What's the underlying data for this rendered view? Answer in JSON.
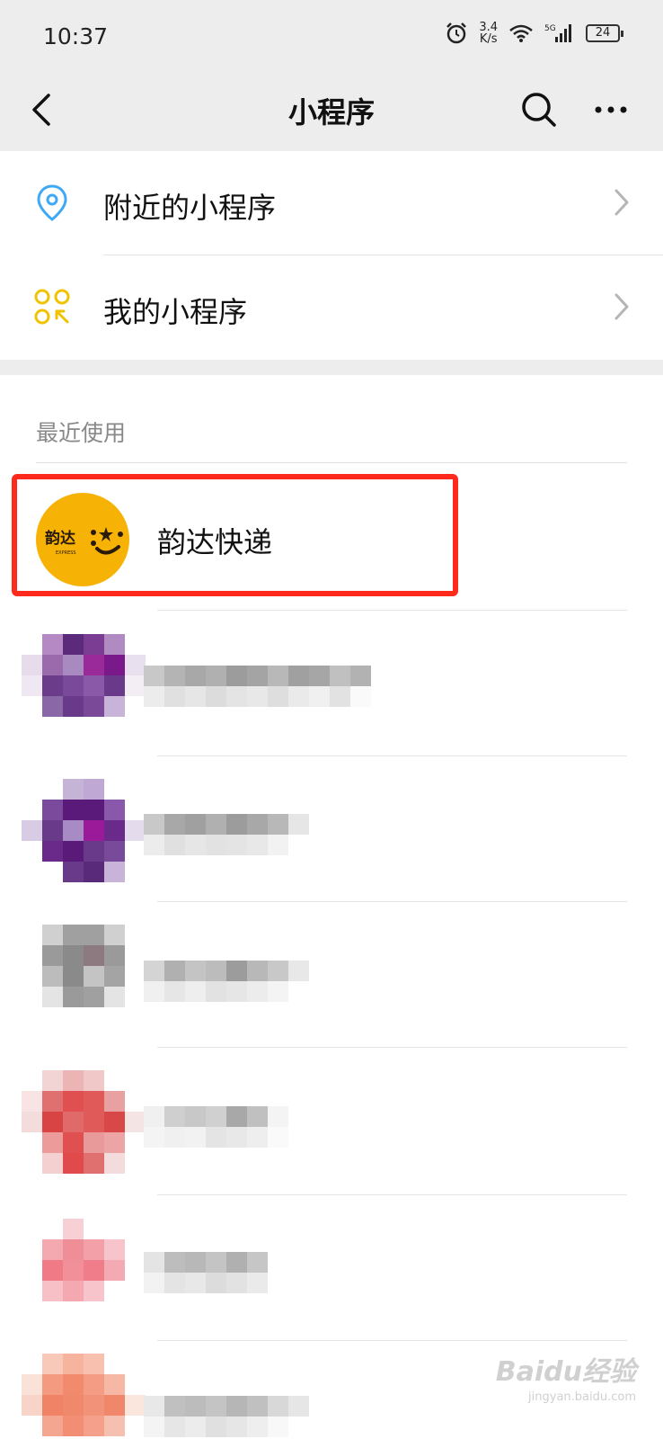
{
  "status_bar": {
    "time": "10:37",
    "network_speed": "3.4 K/s",
    "speed_value": "3.4",
    "speed_unit": "K/s",
    "signal_label": "5G",
    "battery": "24"
  },
  "nav": {
    "title": "小程序",
    "back_icon": "chevron-left-icon",
    "search_icon": "search-icon",
    "more_icon": "more-icon"
  },
  "menu": [
    {
      "label": "附近的小程序",
      "icon": "location-pin-icon",
      "icon_color": "#3fa9f5"
    },
    {
      "label": "我的小程序",
      "icon": "mini-program-grid-icon",
      "icon_color": "#f0c200"
    }
  ],
  "recent": {
    "header": "最近使用",
    "items": [
      {
        "name": "韵达快递",
        "logo_text": "韵达",
        "logo_subtext": "EXPRESS",
        "logo_color": "#f6b306",
        "highlighted": true
      },
      {
        "name": "",
        "obscured": true,
        "tint": "purple"
      },
      {
        "name": "",
        "obscured": true,
        "tint": "purple"
      },
      {
        "name": "",
        "obscured": true,
        "tint": "gray"
      },
      {
        "name": "",
        "obscured": true,
        "tint": "red"
      },
      {
        "name": "",
        "obscured": true,
        "tint": "pink"
      },
      {
        "name": "",
        "obscured": true,
        "tint": "orange"
      }
    ]
  },
  "colors": {
    "header_bg": "#ededed",
    "highlight_border": "#ff2a1c",
    "divider": "#e2e2e2"
  },
  "watermark": {
    "text": "Baidu经验",
    "subtext": "jingyan.baidu.com"
  }
}
